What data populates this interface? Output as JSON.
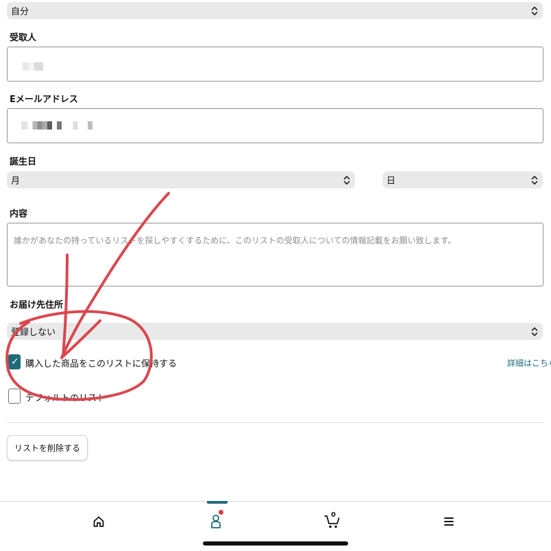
{
  "top_select": {
    "value": "自分"
  },
  "recipient": {
    "label": "受取人",
    "value": ""
  },
  "email": {
    "label": "Eメールアドレス",
    "value": ""
  },
  "birthday": {
    "label": "誕生日",
    "month_value": "月",
    "day_value": "日"
  },
  "content": {
    "label": "内容",
    "placeholder": "誰かがあなたの持っているリストを探しやすくするために、このリストの受取人についての情報記載をお願い致します。"
  },
  "shipping": {
    "label": "お届け先住所",
    "value": "登録しない"
  },
  "keep_purchased": {
    "label": "購入した商品をこのリストに保持する",
    "checked": true,
    "details_link": "詳細はこちら"
  },
  "default_list": {
    "label": "デフォルトのリスト",
    "checked": false
  },
  "delete_button": {
    "label": "リストを削除する"
  },
  "bottom_nav": {
    "items": [
      {
        "icon": "home-icon"
      },
      {
        "icon": "account-icon"
      },
      {
        "icon": "cart-icon"
      },
      {
        "icon": "menu-icon"
      }
    ],
    "cart_count": "0",
    "active_index": 1
  },
  "colors": {
    "accent": "#1e6b7a",
    "annotation": "#d9474f",
    "badge": "#d93b4a"
  }
}
